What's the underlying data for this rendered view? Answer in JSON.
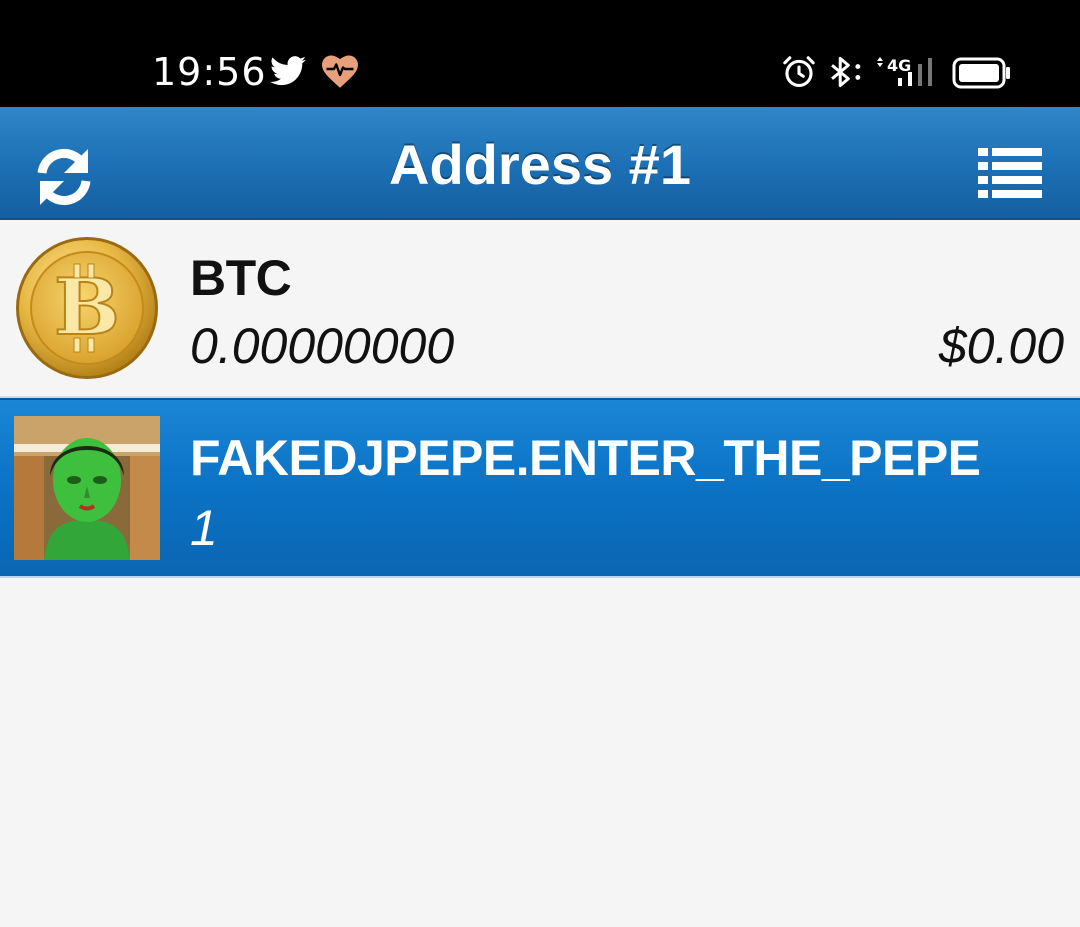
{
  "status_bar": {
    "time": "19:56",
    "network_label": "4G",
    "icons": [
      "twitter-icon",
      "health-heart-icon",
      "alarm-icon",
      "bluetooth-icon",
      "signal-icon",
      "battery-icon"
    ]
  },
  "app_bar": {
    "title": "Address #1",
    "left_icon": "refresh-icon",
    "right_icon": "list-menu-icon"
  },
  "assets": [
    {
      "name": "BTC",
      "balance": "0.00000000",
      "value": "$0.00",
      "icon": "bitcoin-coin-icon",
      "selected": false
    },
    {
      "name": "FAKEDJPEPE.ENTER_THE_PEPE",
      "balance": "1",
      "value": "",
      "icon": "asset-thumbnail",
      "selected": true
    }
  ],
  "colors": {
    "app_bar": "#1c6fb4",
    "selected_row": "#0b72c4",
    "background": "#f5f5f5",
    "status_bar": "#000000",
    "heart_icon": "#e8a07c"
  }
}
